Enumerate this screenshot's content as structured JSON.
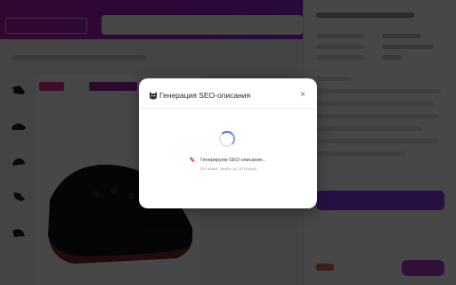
{
  "modal": {
    "title": "Генерация SEO-описания",
    "close_label": "×",
    "logo_icon": "cat-face-icon",
    "status_icon": "bookmark-emoji-icon",
    "status_icon_glyph": "🔖",
    "status_text": "Генерируем SEO-описание...",
    "hint_text": "Это может занять до 10 секунд"
  },
  "colors": {
    "topbar": "#9a1fd0",
    "accent": "#8b3cf0",
    "spinner": "#4a6fd8",
    "overlay": "rgba(0,0,0,0.72)"
  }
}
